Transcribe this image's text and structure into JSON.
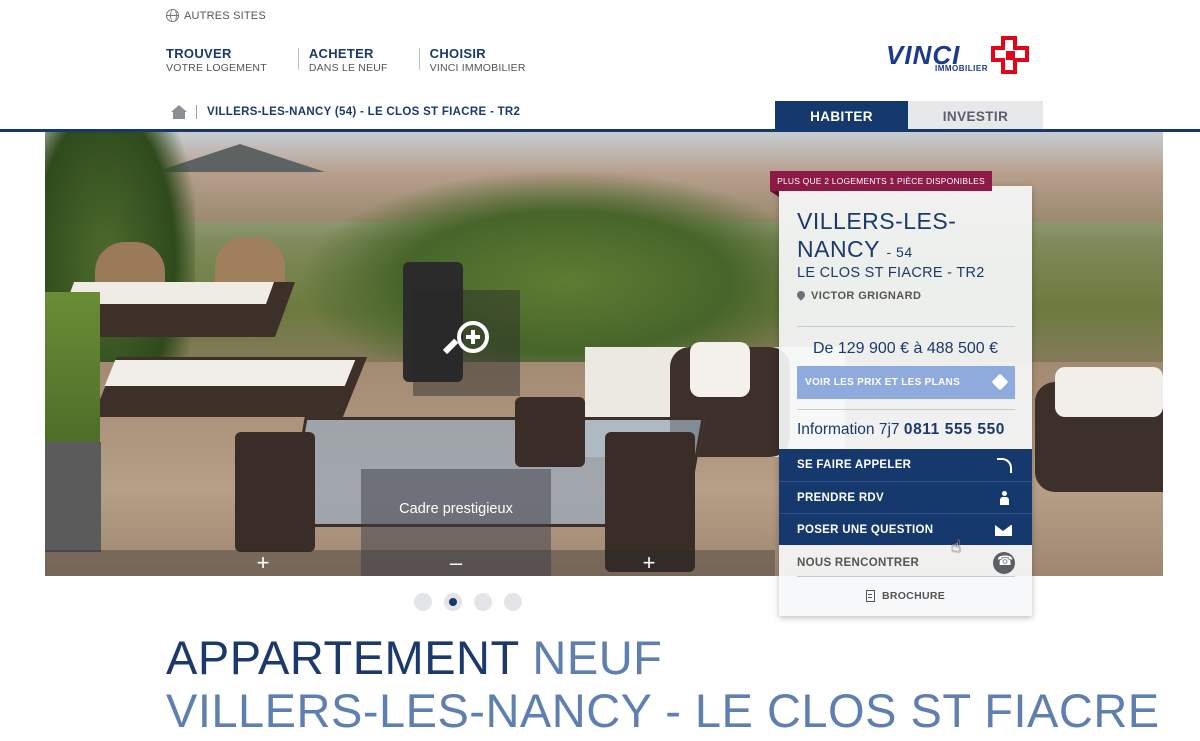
{
  "top": {
    "autres_sites": "AUTRES SITES"
  },
  "nav": {
    "items": [
      {
        "title": "TROUVER",
        "subtitle": "VOTRE LOGEMENT"
      },
      {
        "title": "ACHETER",
        "subtitle": "DANS LE NEUF"
      },
      {
        "title": "CHOISIR",
        "subtitle": "VINCI IMMOBILIER"
      }
    ]
  },
  "logo": {
    "word": "VINCI",
    "sub": "IMMOBILIER",
    "colors": {
      "blue": "#1b3a8a",
      "red": "#e2061a"
    }
  },
  "breadcrumb": {
    "text": "VILLERS-LES-NANCY (54) - LE CLOS ST FIACRE - TR2"
  },
  "tabs": [
    {
      "label": "HABITER",
      "active": true
    },
    {
      "label": "INVESTIR",
      "active": false
    }
  ],
  "hero": {
    "caption": "Cadre prestigieux",
    "controls": [
      "+",
      "–",
      "+"
    ],
    "slides_count": 4,
    "active_slide": 2
  },
  "panel": {
    "ribbon": "PLUS QUE 2 LOGEMENTS 1 PIÈCE DISPONIBLES",
    "city": "VILLERS-LES-NANCY",
    "dept": "- 54",
    "program": "LE CLOS ST FIACRE - TR2",
    "address": "VICTOR GRIGNARD",
    "price": "De 129 900 € à 488 500 €",
    "cta": "VOIR LES PRIX ET LES PLANS",
    "info_label": "Information 7j7",
    "info_phone": "0811 555 550",
    "buttons": [
      {
        "label": "SE FAIRE APPELER",
        "icon": "phone-callback-icon"
      },
      {
        "label": "PRENDRE RDV",
        "icon": "person-icon"
      },
      {
        "label": "POSER UNE QUESTION",
        "icon": "mail-icon"
      }
    ],
    "meet": "NOUS RENCONTRER",
    "brochure": "BROCHURE"
  },
  "heading": {
    "line1_strong": "APPARTEMENT",
    "line1_light": "NEUF",
    "line2": "VILLERS-LES-NANCY - LE CLOS ST FIACRE"
  },
  "colors": {
    "primary": "#15396c",
    "ribbon": "#8b1a47",
    "cta": "#8faadc"
  }
}
